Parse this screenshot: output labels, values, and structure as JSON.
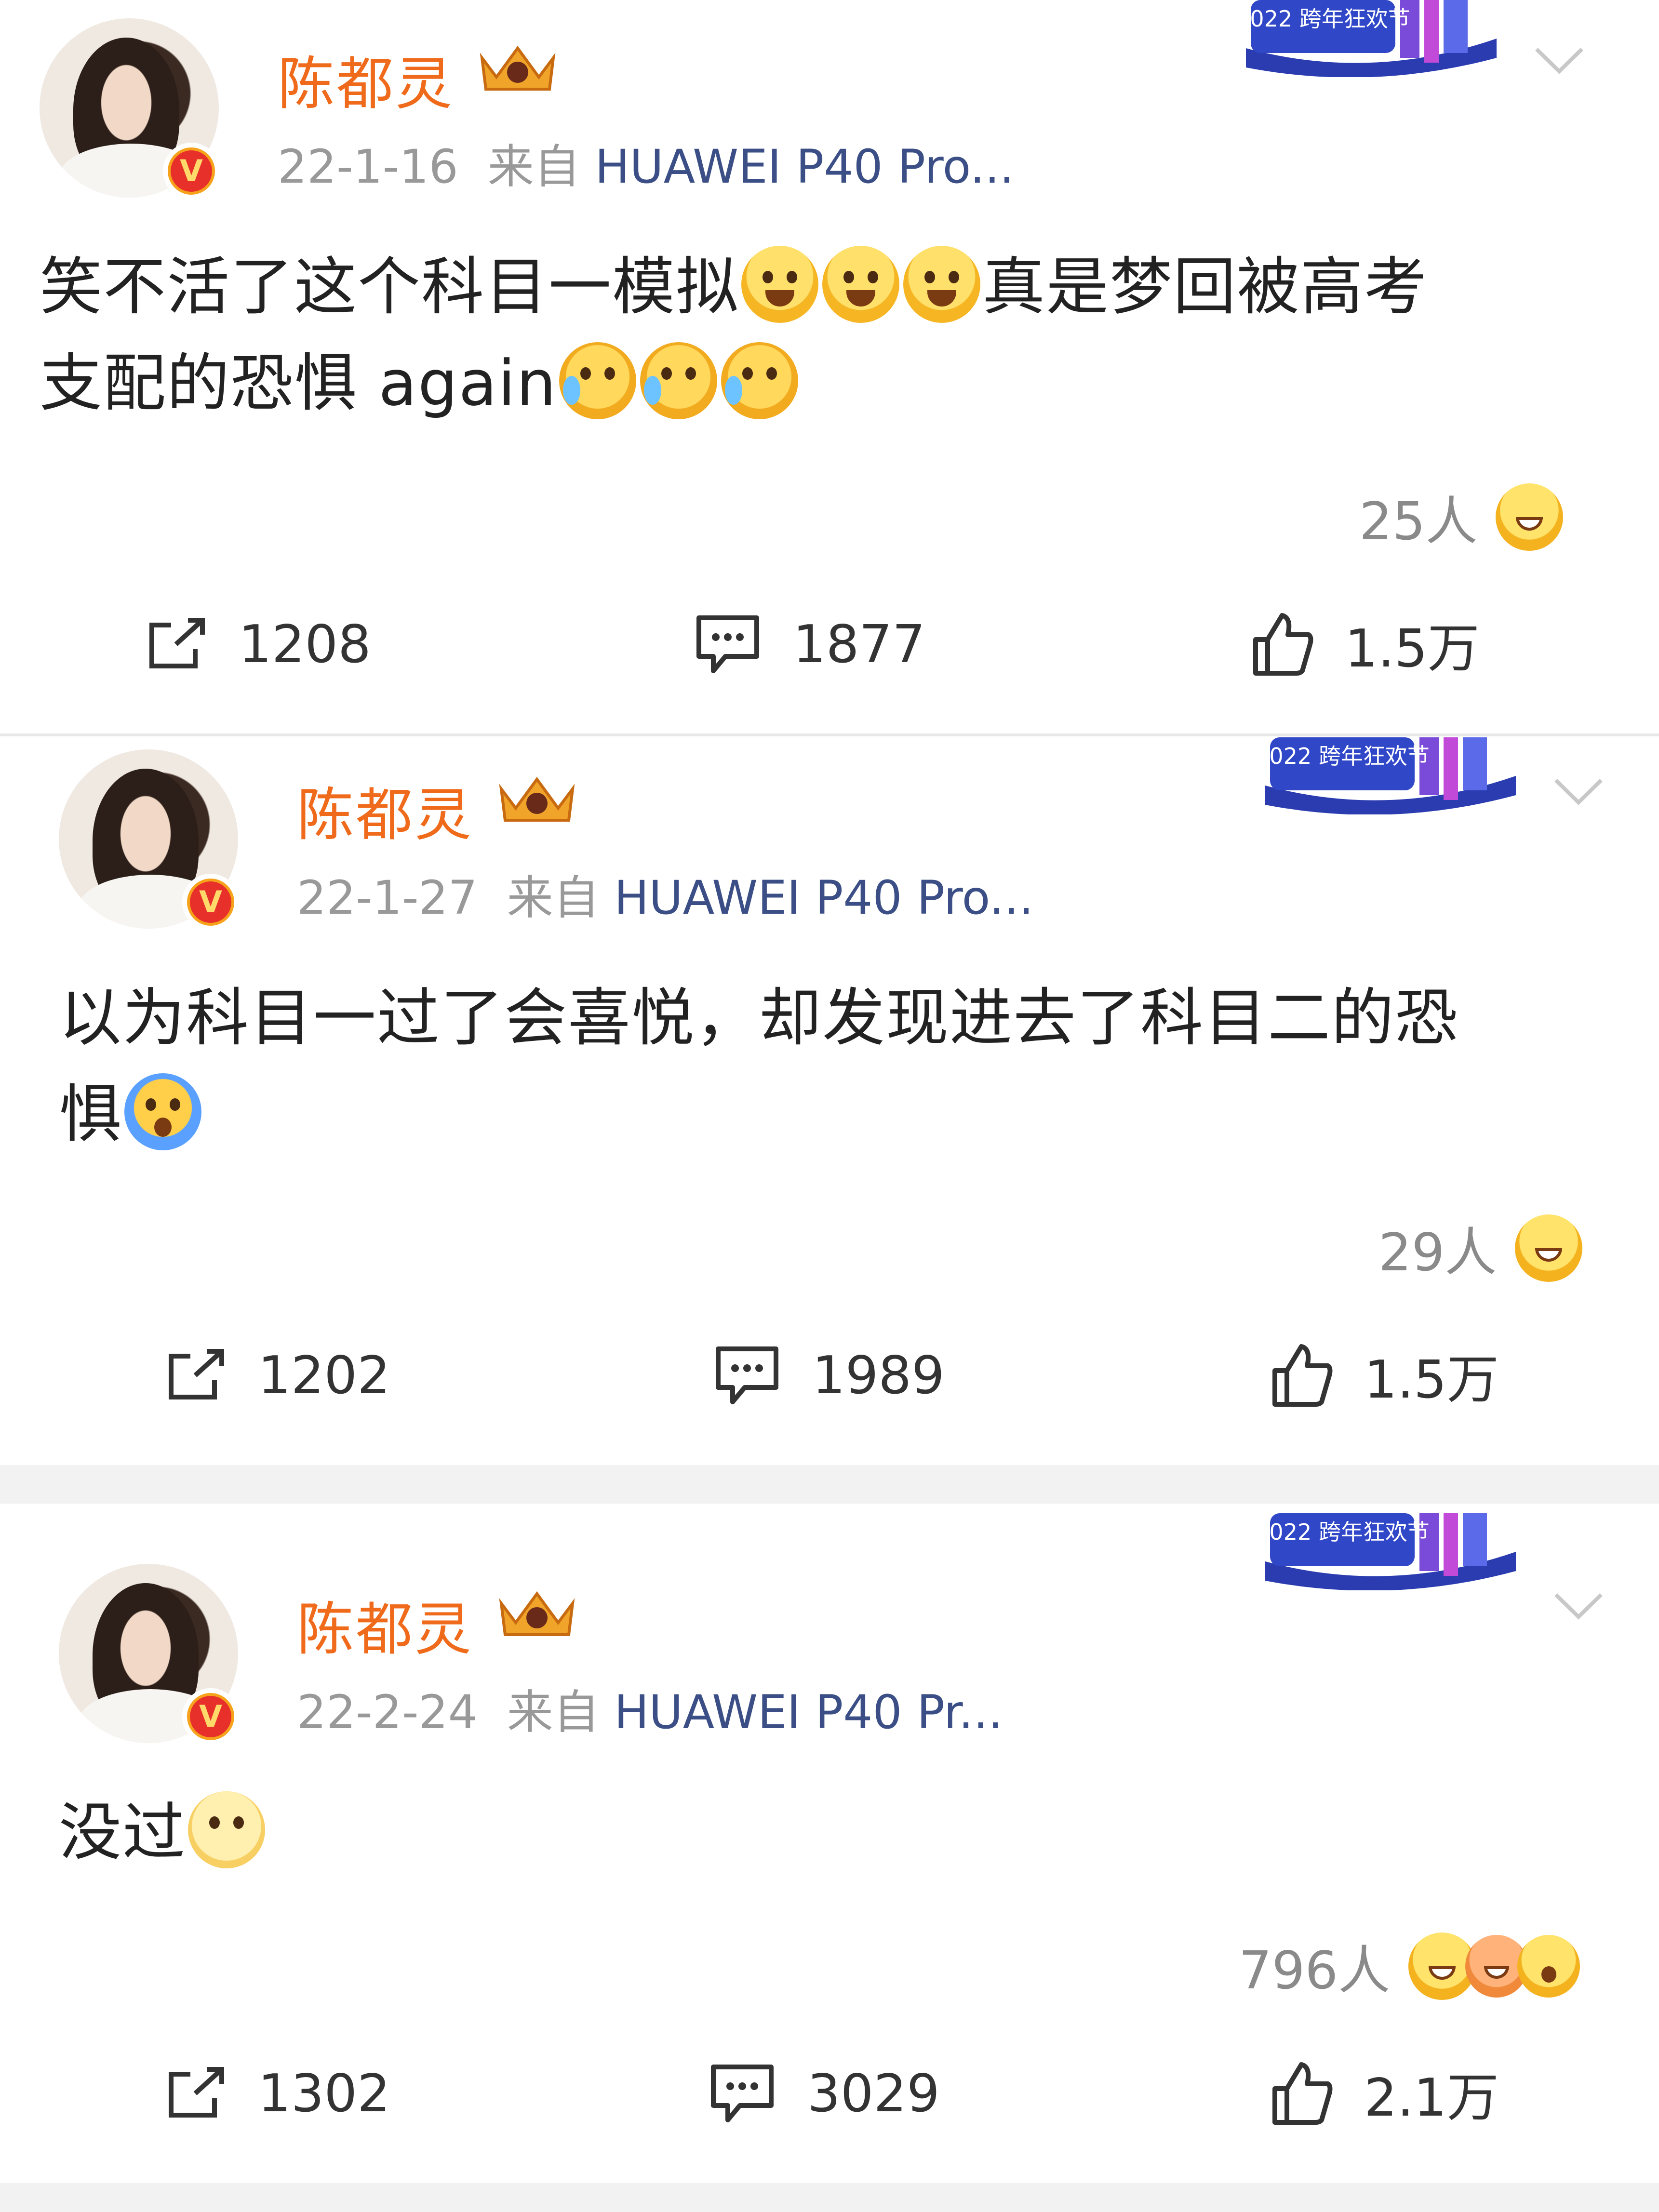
{
  "posts": [
    {
      "user": "陈都灵",
      "date": "22-1-16",
      "source_prefix": "来自",
      "source": "HUAWEI P40 Pro...",
      "text_line1": "笑不活了这个科目一模拟",
      "text_line2_tail": "真是梦回被高考",
      "text_line3": "支配的恐惧 again",
      "reactions": "25人",
      "repost": "1208",
      "comment": "1877",
      "like": "1.5万"
    },
    {
      "user": "陈都灵",
      "date": "22-1-27",
      "source_prefix": "来自",
      "source": "HUAWEI P40 Pro...",
      "text_line1": "以为科目一过了会喜悦，却发现进去了科目二的恐",
      "text_line2": "惧",
      "reactions": "29人",
      "repost": "1202",
      "comment": "1989",
      "like": "1.5万"
    },
    {
      "user": "陈都灵",
      "date": "22-2-24",
      "source_prefix": "来自",
      "source": "HUAWEI P40 Pr...",
      "text_line1": "没过",
      "reactions": "796人",
      "repost": "1302",
      "comment": "3029",
      "like": "2.1万"
    }
  ],
  "banner_text": "2022 跨年狂欢节",
  "colors": {
    "username": "#ef6a1a",
    "source_link": "#3b4f86",
    "meta": "#999999",
    "separator": "#f2f2f2"
  },
  "icons": [
    "repost-icon",
    "comment-icon",
    "like-icon",
    "chevron-down-icon",
    "verified-badge-icon",
    "crown-icon"
  ]
}
